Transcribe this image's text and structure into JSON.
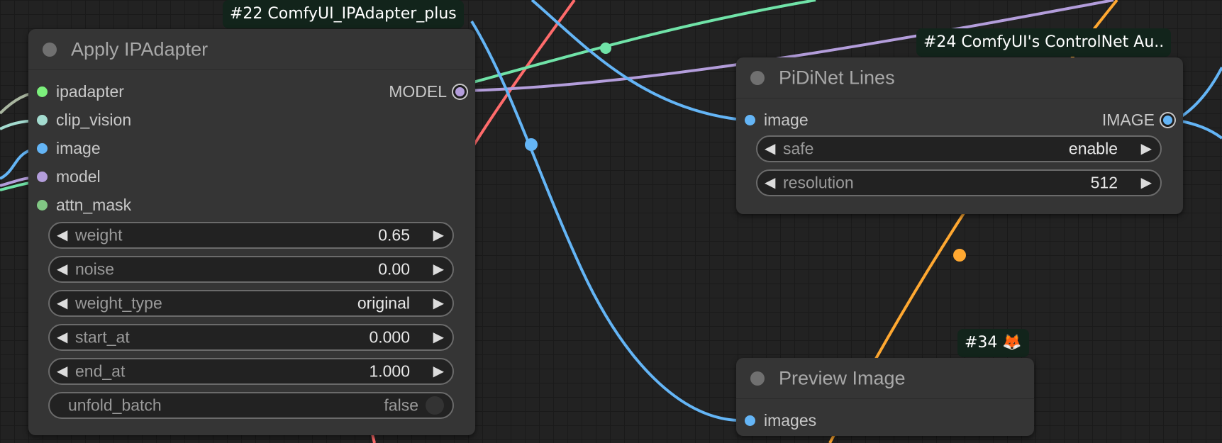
{
  "colors": {
    "ipadapter": "#7cf07c",
    "clip_vision": "#a4dcd0",
    "image": "#64b5f6",
    "model": "#b39ddb",
    "mask": "#81c784",
    "latent_orange": "#ffa831",
    "red_link": "#ff6b6b",
    "green_link": "#70e3a8",
    "node_dot": "#707070"
  },
  "nodes": {
    "apply_ipadapter": {
      "badge": "#22 ComfyUI_IPAdapter_plus",
      "title": "Apply IPAdapter",
      "inputs": [
        {
          "label": "ipadapter",
          "color": "#7cf07c"
        },
        {
          "label": "clip_vision",
          "color": "#a4dcd0"
        },
        {
          "label": "image",
          "color": "#64b5f6"
        },
        {
          "label": "model",
          "color": "#b39ddb"
        },
        {
          "label": "attn_mask",
          "color": "#81c784"
        }
      ],
      "output": {
        "label": "MODEL",
        "color": "#b39ddb"
      },
      "widgets": [
        {
          "name": "weight",
          "value": "0.65"
        },
        {
          "name": "noise",
          "value": "0.00"
        },
        {
          "name": "weight_type",
          "value": "original"
        },
        {
          "name": "start_at",
          "value": "0.000"
        },
        {
          "name": "end_at",
          "value": "1.000"
        }
      ],
      "toggle": {
        "name": "unfold_batch",
        "value": "false"
      }
    },
    "pidinet": {
      "badge": "#24 ComfyUI's ControlNet Au..",
      "title": "PiDiNet Lines",
      "input": {
        "label": "image",
        "color": "#64b5f6"
      },
      "output": {
        "label": "IMAGE",
        "color": "#64b5f6"
      },
      "widgets": [
        {
          "name": "safe",
          "value": "enable"
        },
        {
          "name": "resolution",
          "value": "512"
        }
      ]
    },
    "preview": {
      "badge": "#34 🦊",
      "title": "Preview Image",
      "input": {
        "label": "images",
        "color": "#64b5f6"
      }
    }
  },
  "arrows": {
    "left": "◀",
    "right": "▶"
  }
}
